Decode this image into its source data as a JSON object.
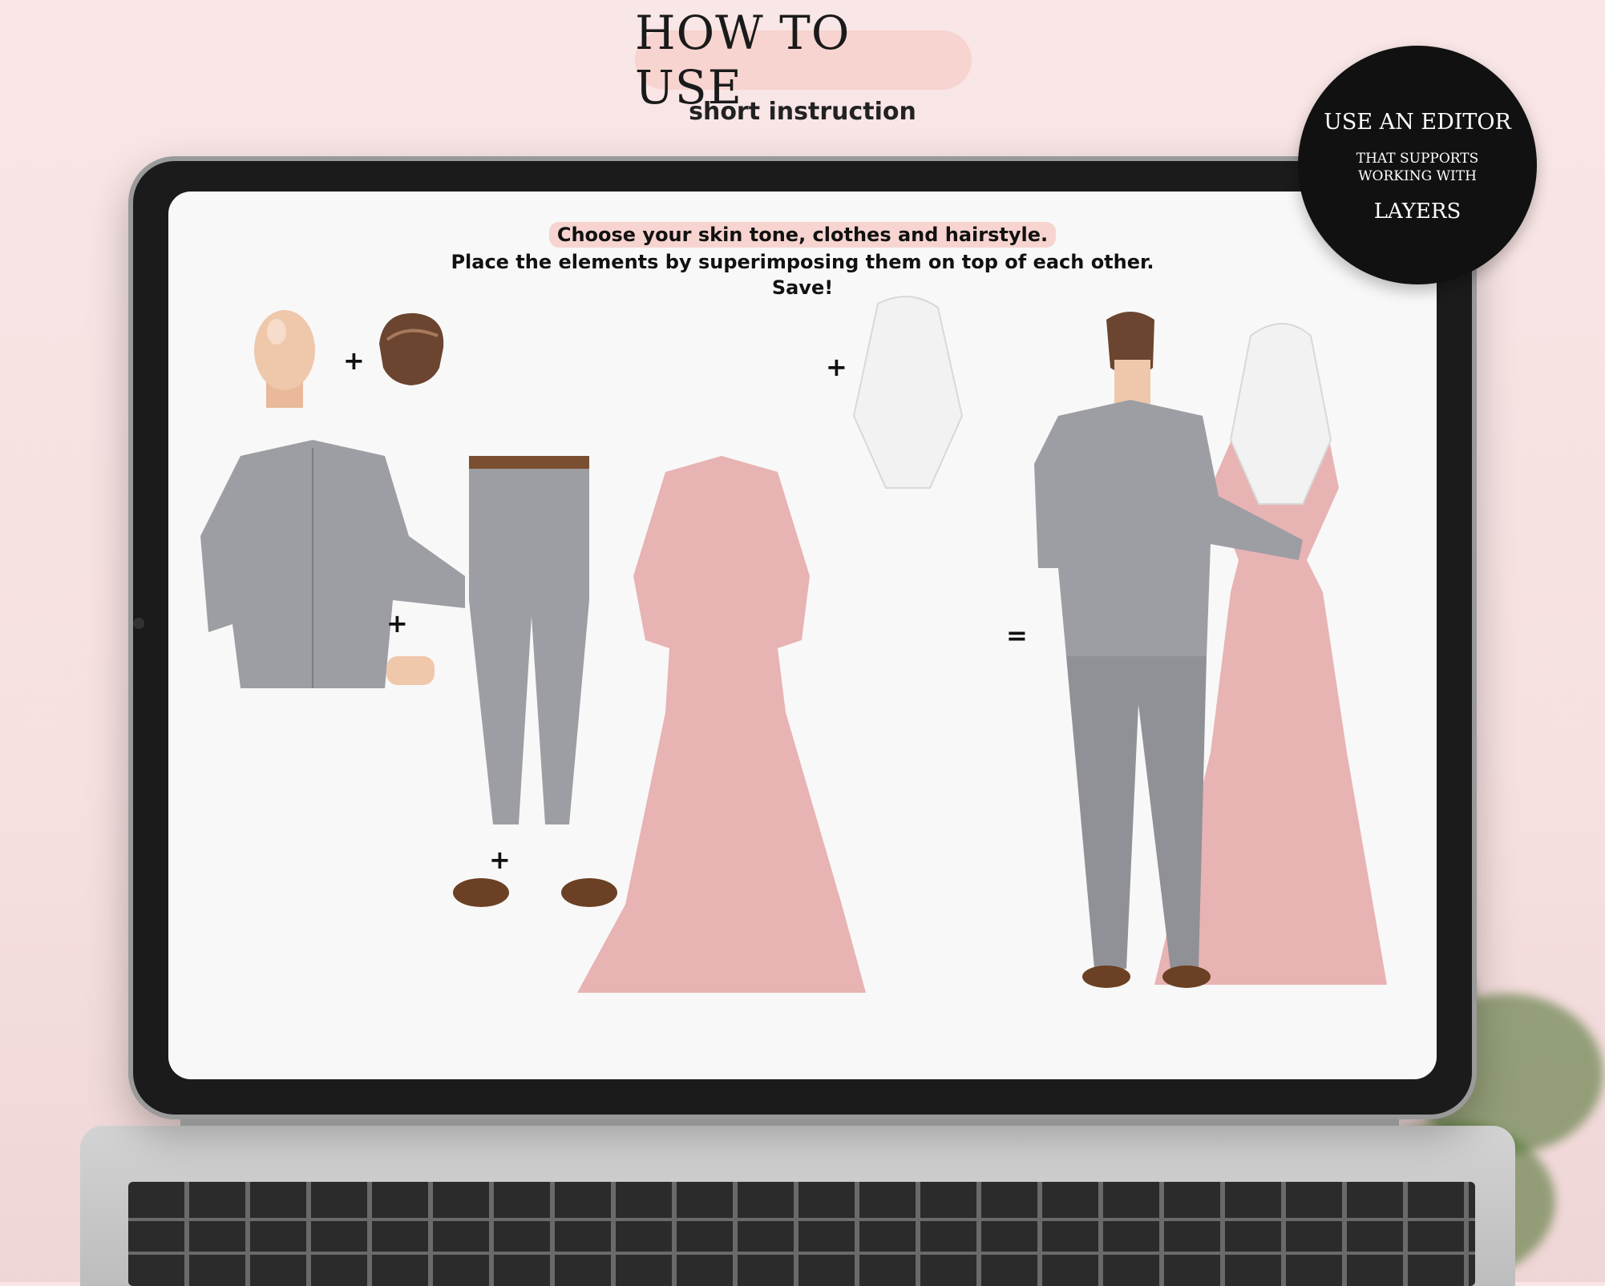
{
  "header": {
    "title": "HOW TO USE",
    "subtitle": "short instruction"
  },
  "badge": {
    "line1": "USE AN EDITOR",
    "line2": "THAT SUPPORTS",
    "line3": "WORKING WITH",
    "line4": "LAYERS"
  },
  "instructions": {
    "line1": "Choose your skin tone, clothes and hairstyle.",
    "line2": "Place the elements by superimposing them on top of each other.",
    "line3": "Save!"
  },
  "operators": {
    "plus": "+",
    "equals": "="
  },
  "colors": {
    "accent_pink": "#f7d4d0",
    "badge_bg": "#111111",
    "suit_gray": "#9c9ea3",
    "dress_pink": "#e8b3b3",
    "hijab_white": "#f2f2f2"
  }
}
